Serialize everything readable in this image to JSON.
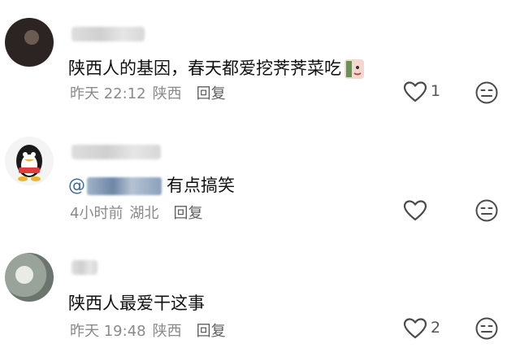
{
  "comments": [
    {
      "text": "陕西人的基因，春天都爱挖荠荠菜吃",
      "time": "昨天 22:12",
      "location": "陕西",
      "reply_label": "回复",
      "likes": "1"
    },
    {
      "mention_prefix": "@",
      "text": "有点搞笑",
      "time": "4小时前",
      "location": "湖北",
      "reply_label": "回复",
      "likes": ""
    },
    {
      "text": "陕西人最爱干这事",
      "time": "昨天 19:48",
      "location": "陕西",
      "reply_label": "回复",
      "likes": "2"
    }
  ],
  "icons": {
    "like": "heart-outline-icon",
    "dislike": "neutral-face-icon"
  },
  "colors": {
    "text": "#111111",
    "meta": "#8a8a8a",
    "icon": "#4a4a4a",
    "mention": "#3b6aa0"
  }
}
